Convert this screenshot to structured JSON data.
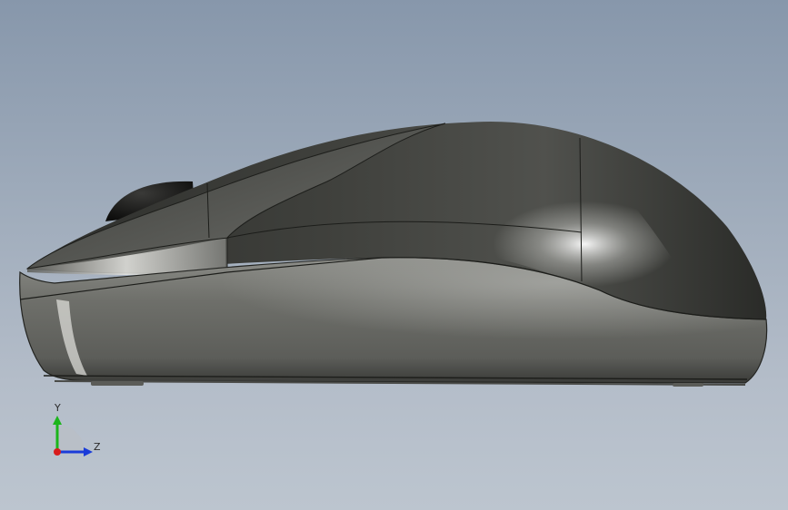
{
  "viewport": {
    "background_top": "#8797ab",
    "background_bottom": "#bcc5cf"
  },
  "model": {
    "body_color": "#6a6b66",
    "highlight_color": "#e8e8e4",
    "shadow_color": "#2a2b28"
  },
  "triad": {
    "y_label": "Y",
    "z_label": "Z",
    "y_color": "#1bb51b",
    "z_color": "#1a3cd9",
    "x_color": "#d81c1c"
  }
}
